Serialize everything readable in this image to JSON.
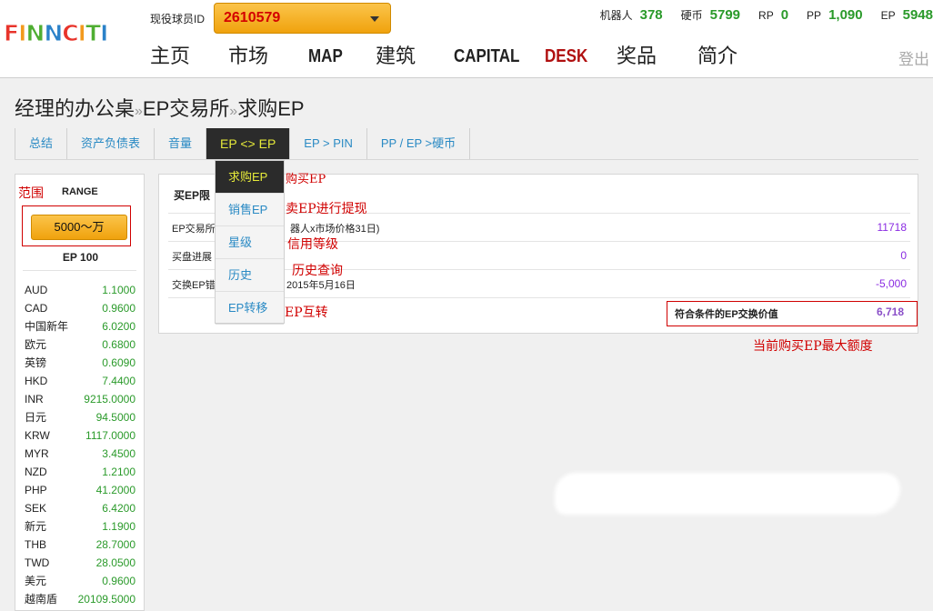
{
  "header": {
    "logo": "FINNCITI",
    "player_id_label": "现役球员ID",
    "player_id_value": "2610579",
    "stats": [
      {
        "label": "机器人",
        "value": "378"
      },
      {
        "label": "硬币",
        "value": "5799"
      },
      {
        "label": "RP",
        "value": "0"
      },
      {
        "label": "PP",
        "value": "1,090"
      },
      {
        "label": "EP",
        "value": "5948"
      }
    ],
    "nav": [
      "主页",
      "市场",
      "MAP",
      "建筑",
      "CAPITAL",
      "DESK",
      "奖品",
      "简介"
    ],
    "logout": "登出"
  },
  "breadcrumb": {
    "part1": "经理的办公桌",
    "sep1": "»",
    "part2": "EP交易所",
    "sep2": "»",
    "part3": "求购EP"
  },
  "tabs": [
    "总结",
    "资产负债表",
    "音量",
    "EP <> EP",
    "EP > PIN",
    "PP / EP >硬币"
  ],
  "dropdown": [
    "求购EP",
    "销售EP",
    "星级",
    "历史",
    "EP转移"
  ],
  "sidebar": {
    "range_label": "RANGE",
    "range_button": "5000〜万",
    "ep_label": "EP 100",
    "rates": [
      {
        "code": "AUD",
        "value": "1.1000"
      },
      {
        "code": "CAD",
        "value": "0.9600"
      },
      {
        "code": "中国新年",
        "value": "6.0200"
      },
      {
        "code": "欧元",
        "value": "0.6800"
      },
      {
        "code": "英镑",
        "value": "0.6090"
      },
      {
        "code": "HKD",
        "value": "7.4400"
      },
      {
        "code": "INR",
        "value": "9215.0000"
      },
      {
        "code": "日元",
        "value": "94.5000"
      },
      {
        "code": "KRW",
        "value": "1117.0000"
      },
      {
        "code": "MYR",
        "value": "3.4500"
      },
      {
        "code": "NZD",
        "value": "1.2100"
      },
      {
        "code": "PHP",
        "value": "41.2000"
      },
      {
        "code": "SEK",
        "value": "6.4200"
      },
      {
        "code": "新元",
        "value": "1.1900"
      },
      {
        "code": "THB",
        "value": "28.7000"
      },
      {
        "code": "TWD",
        "value": "28.0500"
      },
      {
        "code": "美元",
        "value": "0.9600"
      },
      {
        "code": "越南盾",
        "value": "20109.5000"
      }
    ]
  },
  "panel": {
    "title": "买EP限",
    "rows": [
      {
        "label": "EP交易所",
        "mid": "器人x市场价格31日)",
        "value": "11718"
      },
      {
        "label": "买盘进展",
        "mid": "",
        "value": "0"
      },
      {
        "label": "交换EP错",
        "mid": "2015年5月16日",
        "value": "-5,000"
      }
    ],
    "final_label": "符合条件的EP交换价值",
    "final_value": "6,718"
  },
  "annotations": {
    "range": "范围",
    "buy_ep": "购买EP",
    "sell_ep": "卖EP进行提现",
    "credit": "信用等级",
    "history": "历史查询",
    "transfer": "EP互转",
    "max": "当前购买EP最大额度"
  }
}
